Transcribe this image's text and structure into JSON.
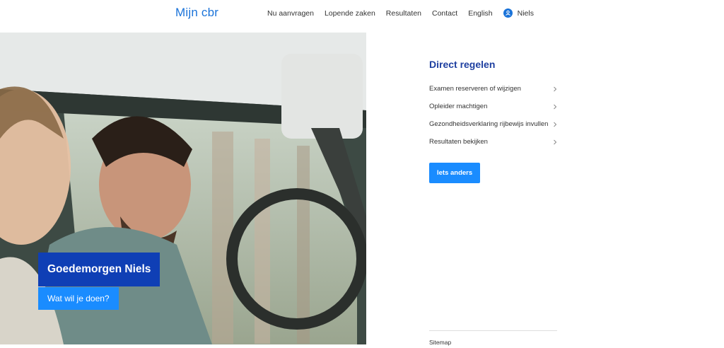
{
  "header": {
    "brand": "Mijn cbr",
    "nav": [
      "Nu aanvragen",
      "Lopende zaken",
      "Resultaten",
      "Contact",
      "English"
    ],
    "user": "Niels",
    "user_icon": "user-icon"
  },
  "hero": {
    "greeting": "Goedemorgen Niels",
    "question": "Wat wil je doen?"
  },
  "direct": {
    "title": "Direct regelen",
    "links": [
      "Examen reserveren of wijzigen",
      "Opleider machtigen",
      "Gezondheidsverklaring rijbewijs invullen",
      "Resultaten bekijken"
    ],
    "cta": "Iets anders"
  },
  "footer": {
    "sitemap": "Sitemap"
  },
  "colors": {
    "brand_blue": "#1a73d9",
    "dark_blue": "#0f3fb5",
    "button_blue": "#1a8cff",
    "title_blue": "#1e3fa0"
  }
}
